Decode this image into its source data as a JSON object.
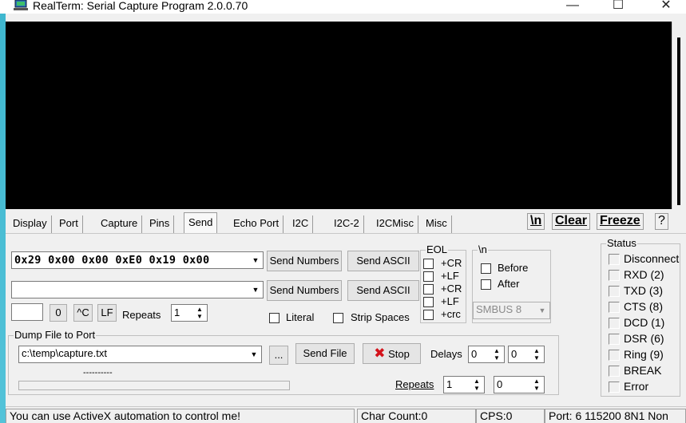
{
  "window": {
    "title": "RealTerm: Serial Capture Program 2.0.0.70",
    "minimize": "—",
    "maximize": "☐",
    "close": "✕"
  },
  "tabs": [
    {
      "label": "Display",
      "active": false
    },
    {
      "label": "Port",
      "active": false
    },
    {
      "label": "Capture",
      "active": false
    },
    {
      "label": "Pins",
      "active": false
    },
    {
      "label": "Send",
      "active": true
    },
    {
      "label": "Echo Port",
      "active": false
    },
    {
      "label": "I2C",
      "active": false
    },
    {
      "label": "I2C-2",
      "active": false
    },
    {
      "label": "I2CMisc",
      "active": false
    },
    {
      "label": "Misc",
      "active": false
    }
  ],
  "toolbar": {
    "newline": "\\n",
    "clear": "Clear",
    "freeze": "Freeze",
    "help": "?"
  },
  "send": {
    "line1_value": "0x29 0x00 0x00 0xE0 0x19 0x00",
    "line2_value": "",
    "send_numbers": "Send Numbers",
    "send_ascii": "Send ASCII",
    "small_value": "",
    "btn_zero": "0",
    "btn_ctrl_c": "^C",
    "btn_lf": "LF",
    "repeats_label": "Repeats",
    "repeats_value": "1",
    "literal": "Literal",
    "strip_spaces": "Strip Spaces"
  },
  "eol": {
    "title": "EOL",
    "cr1": "+CR",
    "lf1": "+LF",
    "cr2": "+CR",
    "lf2": "+LF",
    "crc": "+crc"
  },
  "newline_group": {
    "title": "\\n",
    "before": "Before",
    "after": "After",
    "smbus_value": "SMBUS 8"
  },
  "dump": {
    "title": "Dump File to Port",
    "file_path": "c:\\temp\\capture.txt",
    "browse": "...",
    "send_file": "Send File",
    "stop": "Stop",
    "delays_label": "Delays",
    "delay1": "0",
    "delay2": "0",
    "progress_text": "----------",
    "repeats_label": "Repeats",
    "repeats1": "1",
    "repeats2": "0"
  },
  "status_group": {
    "title": "Status",
    "items": [
      "Disconnect",
      "RXD (2)",
      "TXD (3)",
      "CTS (8)",
      "DCD (1)",
      "DSR (6)",
      "Ring (9)",
      "BREAK",
      "Error"
    ]
  },
  "statusbar": {
    "message": "You can use ActiveX automation to control me!",
    "char_count": "Char Count:0",
    "cps": "CPS:0",
    "port": "Port: 6 115200 8N1 Non"
  }
}
